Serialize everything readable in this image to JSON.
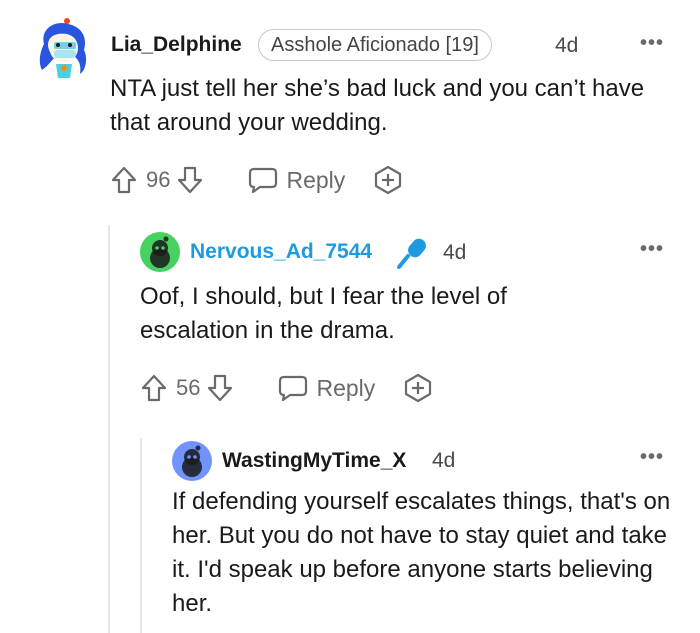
{
  "comments": [
    {
      "username": "Lia_Delphine",
      "flair": "Asshole Aficionado [19]",
      "age": "4d",
      "body": "NTA just tell her she’s bad luck and you can’t have that around your wedding.",
      "votes": "96",
      "reply_label": "Reply"
    },
    {
      "username": "Nervous_Ad_7544",
      "age": "4d",
      "body": "Oof, I should, but I fear the level of escalation in the drama.",
      "votes": "56",
      "reply_label": "Reply",
      "username_color": "#1e9be0",
      "badge_icon": "microphone-icon"
    },
    {
      "username": "WastingMyTime_X",
      "age": "4d",
      "body": "If defending yourself escalates things, that's on her. But you do not have to stay quiet and take it. I'd speak up before anyone starts believing her."
    }
  ],
  "more_options": "•••",
  "colors": {
    "accent": "#1e9be0",
    "muted": "#6a6a6a",
    "thread_line": "#e6e6e6"
  }
}
